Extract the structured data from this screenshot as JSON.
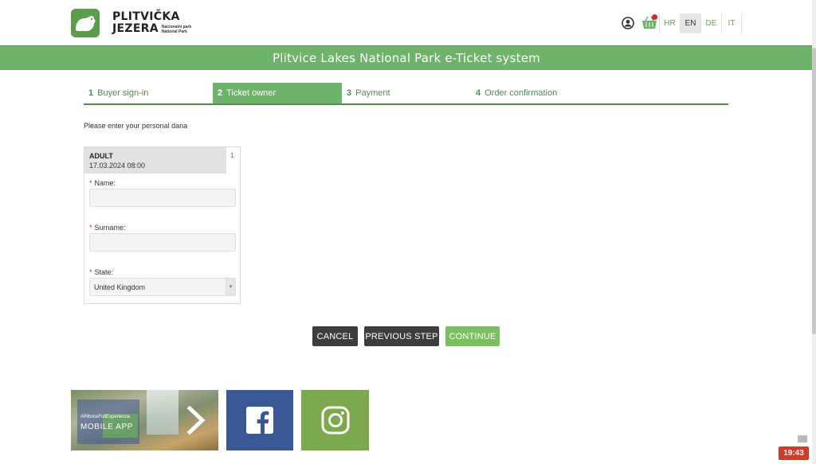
{
  "header": {
    "logo_line1": "PLITVIČKA",
    "logo_line2": "JEZERA",
    "logo_sub1": "Nacionalni park",
    "logo_sub2": "National Park",
    "languages": [
      "HR",
      "EN",
      "DE",
      "IT"
    ],
    "active_language": "EN"
  },
  "title": "Plitvice Lakes National Park e-Ticket system",
  "steps": [
    {
      "num": "1",
      "label": "Buyer sign-in"
    },
    {
      "num": "2",
      "label": "Ticket owner"
    },
    {
      "num": "3",
      "label": "Payment"
    },
    {
      "num": "4",
      "label": "Order confirmation"
    }
  ],
  "active_step": 2,
  "instruction": "Please enter your personal dana",
  "ticket": {
    "type": "ADULT",
    "datetime": "17.03.2024 08:00",
    "count": "1"
  },
  "form": {
    "required_mark": "*",
    "name_label": "Name:",
    "name_value": "",
    "surname_label": "Surname:",
    "surname_value": "",
    "state_label": "State:",
    "state_value": "United Kingdom"
  },
  "buttons": {
    "cancel": "CANCEL",
    "previous": "PREVIOUS STEP",
    "continue": "CONTINUE"
  },
  "footer": {
    "app_hashtag": "#PlitviceFullExperience",
    "app_label": "MOBILE APP"
  },
  "clock": "19:43",
  "colors": {
    "brand_green": "#6db36a",
    "dark_green": "#4e8f4b",
    "continue_green": "#7bbf5e",
    "dark_button": "#3d3d3d",
    "facebook_blue": "#3a5795",
    "instagram_green": "#7ba94c"
  }
}
